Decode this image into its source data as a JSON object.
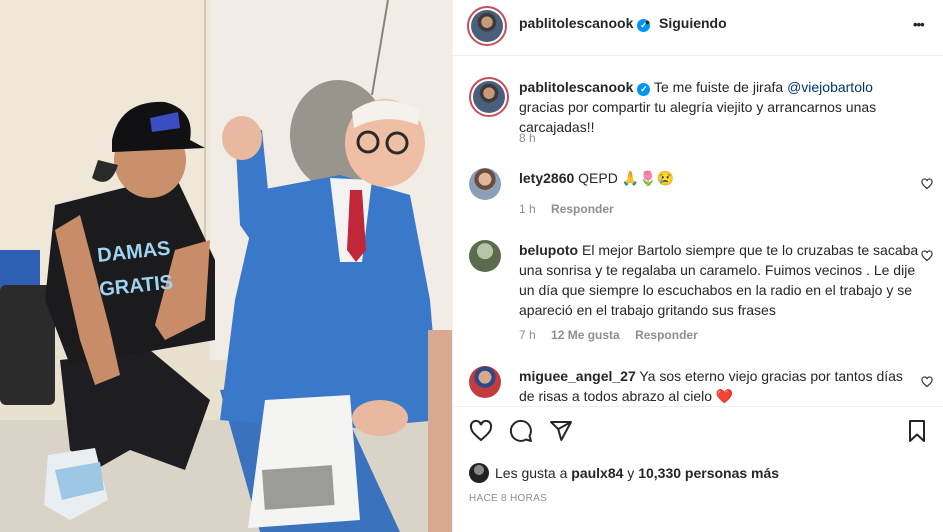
{
  "header": {
    "username": "pablitolescanook",
    "separator": "•",
    "follow_status": "Siguiendo",
    "more_label": "•••"
  },
  "caption": {
    "username": "pablitolescanook",
    "text_before": "Te me fuiste de jirafa ",
    "mention": "@viejobartolo",
    "text_after": " gracias por compartir tu alegría viejito y arrancarnos unas carcajadas!!",
    "time": "8 h"
  },
  "comments": [
    {
      "username": "lety2860",
      "text": "QEPD 🙏🌷😢",
      "time": "1 h",
      "likes": "",
      "reply": "Responder"
    },
    {
      "username": "belupoto",
      "text": "El mejor Bartolo siempre que te lo cruzabas te sacaba una sonrisa y te regalaba un caramelo. Fuimos vecinos . Le dije un día que siempre lo escuchabos en la radio en el trabajo y se apareció en el trabajo gritando sus frases",
      "time": "7 h",
      "likes": "12 Me gusta",
      "reply": "Responder"
    },
    {
      "username": "miguee_angel_27",
      "text": "Ya sos eterno viejo gracias por tantos días de risas a todos abrazo al cielo ❤️",
      "time": "",
      "likes": "",
      "reply": ""
    }
  ],
  "likes": {
    "prefix": "Les gusta a ",
    "user": "paulx84",
    "middle": " y ",
    "count": "10,330 personas más"
  },
  "timestamp": "HACE 8 HORAS",
  "photo": {
    "shirt_text_line1": "DAMAS",
    "shirt_text_line2": "GRATIS"
  },
  "colors": {
    "verified": "#0095f6",
    "secondary_text": "#8e8e8e",
    "mention_link": "#00376b",
    "heart_red": "#ed4956",
    "suit_blue": "#3a78c9"
  },
  "icons": [
    "verified-icon",
    "more-options-icon",
    "heart-icon",
    "comment-icon",
    "share-icon",
    "save-icon"
  ]
}
